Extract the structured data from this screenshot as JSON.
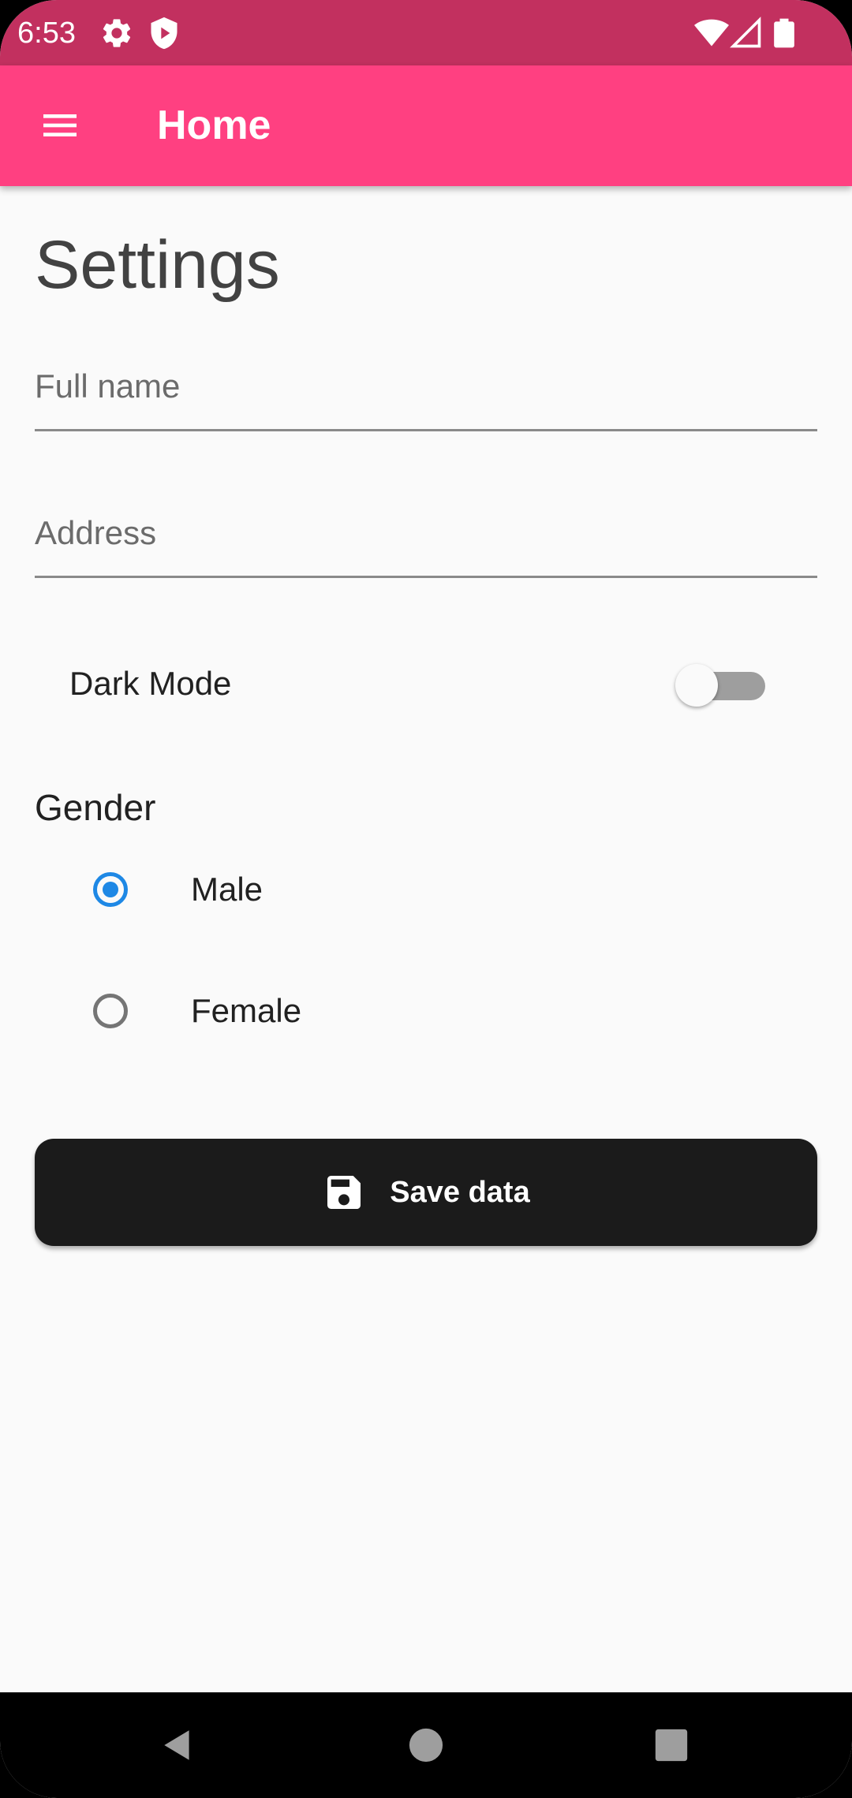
{
  "status_bar": {
    "time": "6:53",
    "icons": [
      "settings-icon",
      "shield-icon",
      "wifi-icon",
      "cellular-signal-icon",
      "battery-icon"
    ],
    "background": "#c2305f"
  },
  "app_bar": {
    "title": "Home",
    "menu_icon": "hamburger-menu-icon",
    "background": "#ff4081"
  },
  "settings": {
    "title": "Settings",
    "full_name": {
      "placeholder": "Full name",
      "value": ""
    },
    "address": {
      "placeholder": "Address",
      "value": ""
    },
    "dark_mode": {
      "label": "Dark Mode",
      "enabled": false
    },
    "gender": {
      "label": "Gender",
      "options": [
        {
          "label": "Male",
          "selected": true
        },
        {
          "label": "Female",
          "selected": false
        }
      ]
    },
    "save_button": {
      "label": "Save data",
      "icon": "floppy-disk-save-icon"
    }
  },
  "colors": {
    "accent": "#1e88e5",
    "button": "#1b1b1b"
  },
  "nav_bar": {
    "buttons": [
      "back-icon",
      "home-icon",
      "recents-icon"
    ]
  }
}
